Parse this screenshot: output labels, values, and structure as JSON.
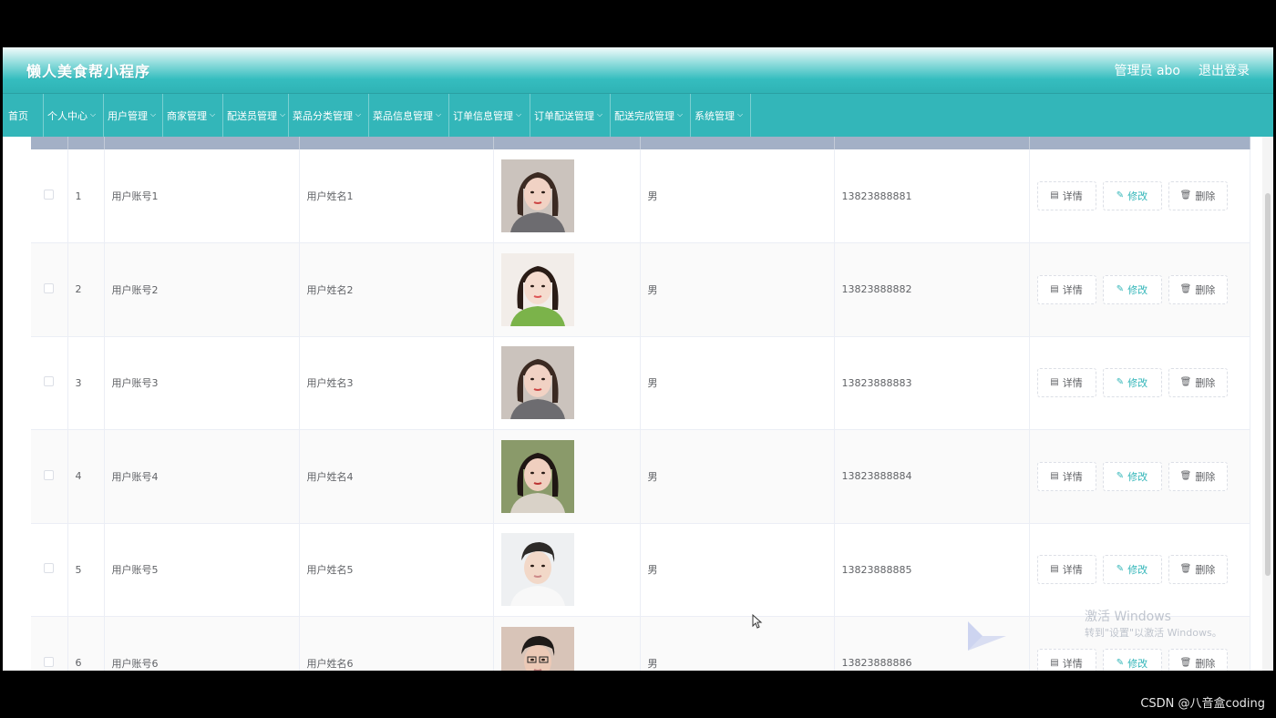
{
  "header": {
    "title": "懒人美食帮小程序",
    "user_label": "管理员 abo",
    "logout_label": "退出登录"
  },
  "nav": [
    {
      "label": "首页",
      "has_dropdown": false
    },
    {
      "label": "个人中心",
      "has_dropdown": true
    },
    {
      "label": "用户管理",
      "has_dropdown": true
    },
    {
      "label": "商家管理",
      "has_dropdown": true
    },
    {
      "label": "配送员管理",
      "has_dropdown": true
    },
    {
      "label": "菜品分类管理",
      "has_dropdown": true
    },
    {
      "label": "菜品信息管理",
      "has_dropdown": true
    },
    {
      "label": "订单信息管理",
      "has_dropdown": true
    },
    {
      "label": "订单配送管理",
      "has_dropdown": true
    },
    {
      "label": "配送完成管理",
      "has_dropdown": true
    },
    {
      "label": "系统管理",
      "has_dropdown": true
    }
  ],
  "table": {
    "rows": [
      {
        "index": "1",
        "account": "用户账号1",
        "name": "用户姓名1",
        "gender": "男",
        "phone": "13823888881",
        "avatar_style": "woman-gray-top"
      },
      {
        "index": "2",
        "account": "用户账号2",
        "name": "用户姓名2",
        "gender": "男",
        "phone": "13823888882",
        "avatar_style": "woman-green-top"
      },
      {
        "index": "3",
        "account": "用户账号3",
        "name": "用户姓名3",
        "gender": "男",
        "phone": "13823888883",
        "avatar_style": "woman-gray-top"
      },
      {
        "index": "4",
        "account": "用户账号4",
        "name": "用户姓名4",
        "gender": "男",
        "phone": "13823888884",
        "avatar_style": "woman-outdoor"
      },
      {
        "index": "5",
        "account": "用户账号5",
        "name": "用户姓名5",
        "gender": "男",
        "phone": "13823888885",
        "avatar_style": "man-white-top"
      },
      {
        "index": "6",
        "account": "用户账号6",
        "name": "用户姓名6",
        "gender": "男",
        "phone": "13823888886",
        "avatar_style": "man-glasses"
      }
    ],
    "actions": {
      "detail": "详情",
      "edit": "修改",
      "delete": "删除"
    }
  },
  "watermark": {
    "line1": "激活 Windows",
    "line2": "转到\"设置\"以激活 Windows。",
    "source": "CSDN @八音盒coding"
  },
  "colors": {
    "accent": "#33b6b9",
    "header_row": "#a3b0c6"
  }
}
